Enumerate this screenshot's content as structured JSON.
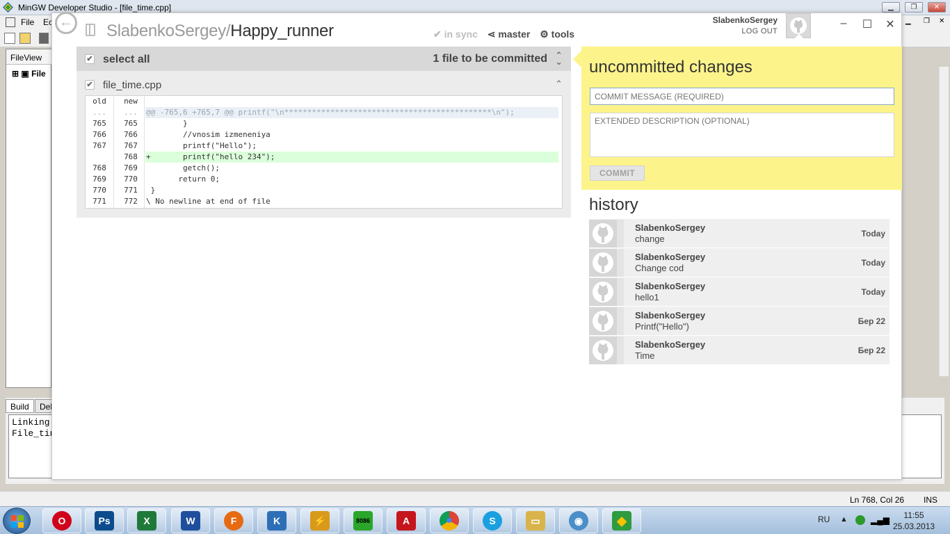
{
  "bg_window": {
    "title": "MinGW Developer Studio - [file_time.cpp]",
    "menu": [
      "File",
      "Ec"
    ],
    "fileview_tab": "FileView",
    "fileview_node": "File",
    "bottom_tabs": [
      "Build",
      "Deb"
    ],
    "output_lines": [
      "Linking",
      "",
      "File_tin"
    ],
    "status_pos": "Ln 768, Col 26",
    "status_mode": "INS"
  },
  "github": {
    "repo_owner": "SlabenkoSergey/",
    "repo_name": "Happy_runner",
    "nav": {
      "sync": "in sync",
      "branch": "master",
      "tools": "tools"
    },
    "user": {
      "name": "SlabenkoSergey",
      "logout": "LOG OUT"
    },
    "changes": {
      "select_all": "select all",
      "count_label": "1 file to be committed",
      "file_name": "file_time.cpp",
      "diff_header": {
        "old": "old",
        "new": "new"
      },
      "diff_rows": [
        {
          "type": "hunk",
          "old": "...",
          "new": "...",
          "code": "@@ -765,6 +765,7 @@ printf(\"\\n*********************************************\\n\");"
        },
        {
          "type": "ctx",
          "old": "765",
          "new": "765",
          "code": "        }"
        },
        {
          "type": "ctx",
          "old": "766",
          "new": "766",
          "code": "        //vnosim izmeneniya"
        },
        {
          "type": "ctx",
          "old": "767",
          "new": "767",
          "code": "        printf(\"Hello\");"
        },
        {
          "type": "add",
          "old": "",
          "new": "768",
          "code": "+       printf(\"hello 234\");"
        },
        {
          "type": "ctx",
          "old": "768",
          "new": "769",
          "code": "        getch();"
        },
        {
          "type": "ctx",
          "old": "769",
          "new": "770",
          "code": "       return 0;"
        },
        {
          "type": "ctx",
          "old": "770",
          "new": "771",
          "code": " }"
        },
        {
          "type": "ctx",
          "old": "771",
          "new": "772",
          "code": "\\ No newline at end of file"
        }
      ]
    },
    "uncommitted": {
      "title": "uncommitted changes",
      "message_placeholder": "COMMIT MESSAGE (REQUIRED)",
      "description_placeholder": "EXTENDED DESCRIPTION (OPTIONAL)",
      "commit_label": "COMMIT"
    },
    "history": {
      "title": "history",
      "items": [
        {
          "author": "SlabenkoSergey",
          "message": "change",
          "date": "Today"
        },
        {
          "author": "SlabenkoSergey",
          "message": "Change cod",
          "date": "Today"
        },
        {
          "author": "SlabenkoSergey",
          "message": "hello1",
          "date": "Today"
        },
        {
          "author": "SlabenkoSergey",
          "message": "Printf(\"Hello\")",
          "date": "Бер 22"
        },
        {
          "author": "SlabenkoSergey",
          "message": "Time",
          "date": "Бер 22"
        }
      ]
    }
  },
  "taskbar": {
    "apps": [
      {
        "name": "opera",
        "label": "O",
        "color": "#d0021b"
      },
      {
        "name": "photoshop",
        "label": "Ps",
        "color": "#0b4c8c"
      },
      {
        "name": "excel",
        "label": "X",
        "color": "#1f7a3a"
      },
      {
        "name": "word",
        "label": "W",
        "color": "#1f4e9c"
      },
      {
        "name": "firefox",
        "label": "F",
        "color": "#e66a12"
      },
      {
        "name": "app-blue",
        "label": "K",
        "color": "#2c6fb7"
      },
      {
        "name": "winamp",
        "label": "⚡",
        "color": "#d99a1c"
      },
      {
        "name": "emu8086",
        "label": "8086",
        "color": "#2aa62a"
      },
      {
        "name": "acrobat",
        "label": "A",
        "color": "#c4161c"
      },
      {
        "name": "chrome",
        "label": "●",
        "color": "#e0a91b"
      },
      {
        "name": "skype",
        "label": "S",
        "color": "#1aa0e0"
      },
      {
        "name": "explorer",
        "label": "▭",
        "color": "#d9b44a"
      },
      {
        "name": "github",
        "label": "◉",
        "color": "#4b8ec8"
      },
      {
        "name": "mingw",
        "label": "◆",
        "color": "#2e9b3e"
      }
    ],
    "tray": {
      "lang": "RU",
      "time": "11:55",
      "date": "25.03.2013"
    }
  }
}
